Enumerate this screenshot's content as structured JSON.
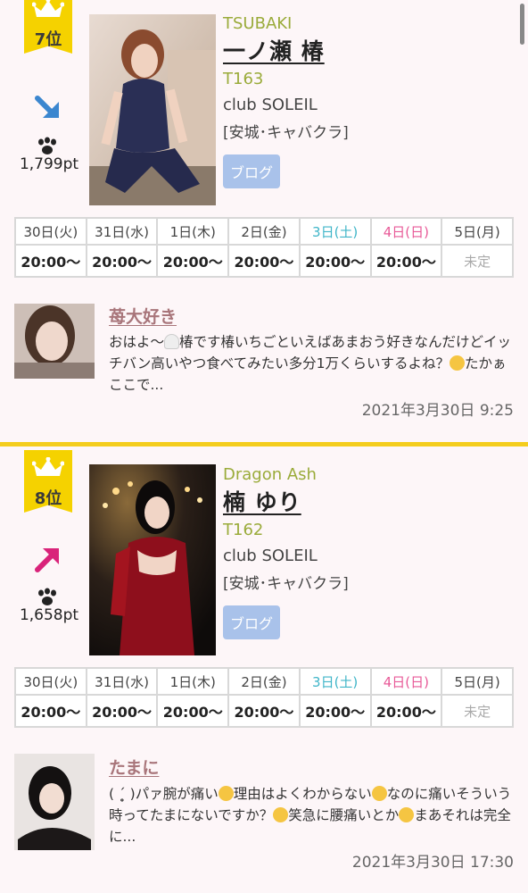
{
  "entries": [
    {
      "rank": "7位",
      "trend": "down",
      "points": "1,799pt",
      "en_name": "TSUBAKI",
      "jp_name": "一ノ瀬 椿",
      "height": "T163",
      "club": "club SOLEIL",
      "area": "[安城･キャバクラ]",
      "blog_label": "ブログ",
      "schedule": {
        "days": [
          "30日(火)",
          "31日(水)",
          "1日(木)",
          "2日(金)",
          "3日(土)",
          "4日(日)",
          "5日(月)"
        ],
        "times": [
          "20:00〜",
          "20:00〜",
          "20:00〜",
          "20:00〜",
          "20:00〜",
          "20:00〜",
          "未定"
        ]
      },
      "post": {
        "title": "苺大好き",
        "body_1": "おはよ〜",
        "body_2": "椿です椿いちごといえばあまおう好きなんだけどイッチバン高いやつ食べてみたい多分1万くらいするよね？",
        "body_3": "たかぁここで...",
        "date": "2021年3月30日 9:25"
      }
    },
    {
      "rank": "8位",
      "trend": "up",
      "points": "1,658pt",
      "en_name": "Dragon Ash",
      "jp_name": "楠 ゆり",
      "height": "T162",
      "club": "club SOLEIL",
      "area": "[安城･キャバクラ]",
      "blog_label": "ブログ",
      "schedule": {
        "days": [
          "30日(火)",
          "31日(水)",
          "1日(木)",
          "2日(金)",
          "3日(土)",
          "4日(日)",
          "5日(月)"
        ],
        "times": [
          "20:00〜",
          "20:00〜",
          "20:00〜",
          "20:00〜",
          "20:00〜",
          "20:00〜",
          "未定"
        ]
      },
      "post": {
        "title": "たまに",
        "body_1": "( ´̥̥̥ )パァ腕が痛い",
        "body_2": "理由はよくわからない",
        "body_3": "なのに痛いそういう時ってたまにないですか？",
        "body_4": "笑急に腰痛いとか",
        "body_5": "まあそれは完全に...",
        "date": "2021年3月30日 17:30"
      }
    }
  ],
  "colors": {
    "accent_yellow": "#f5d200",
    "name_green": "#9aab3a",
    "blog_button": "#a9c2ea",
    "saturday": "#3fb5c8",
    "sunday": "#e85a98",
    "post_title": "#a8757a",
    "trend_down": "#3b86cf",
    "trend_up": "#d9237a"
  }
}
